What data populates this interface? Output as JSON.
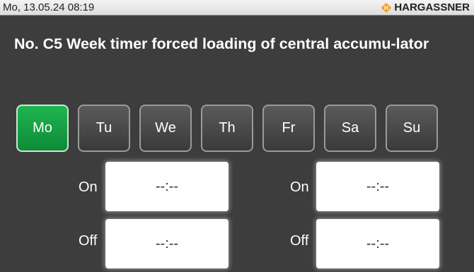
{
  "status_bar": {
    "datetime": "Mo, 13.05.24 08:19",
    "brand": "HARGASSNER",
    "brand_icon": "hargassner-logo-icon",
    "brand_color": "#f0a020"
  },
  "title": "No. C5 Week timer forced loading of central accumu-lator",
  "days": [
    {
      "label": "Mo",
      "active": true
    },
    {
      "label": "Tu",
      "active": false
    },
    {
      "label": "We",
      "active": false
    },
    {
      "label": "Th",
      "active": false
    },
    {
      "label": "Fr",
      "active": false
    },
    {
      "label": "Sa",
      "active": false
    },
    {
      "label": "Su",
      "active": false
    }
  ],
  "timer": {
    "on_label": "On",
    "off_label": "Off",
    "slot1": {
      "on": "--:--",
      "off": "--:--"
    },
    "slot2": {
      "on": "--:--",
      "off": "--:--"
    }
  },
  "colors": {
    "background": "#3d3d3d",
    "active_day": "#1fa046"
  }
}
